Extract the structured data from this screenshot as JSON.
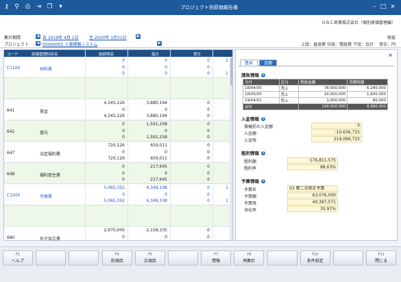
{
  "window": {
    "title": "プロジェクト別原価報告書"
  },
  "header": {
    "period_label": "集計期間",
    "project_label": "プロジェクト",
    "period_from": "自 2019年 4月 1日",
    "period_to": "至 2020年 3月31日",
    "project_value": "00000001 人事情報システム",
    "company": "ＯＢＣ商事株式会社（個別原価管理編）",
    "tax": "税抜",
    "legend": "上段：直接費 中段：間接費 下段：合計",
    "unit": "単位：円"
  },
  "grid": {
    "headers": [
      "コード",
      "原価管理科目名",
      "総経残高",
      "借方",
      "貸方"
    ],
    "rows": [
      {
        "code": "C1100",
        "name": "材料費",
        "blue": true,
        "green": false,
        "cells": [
          [
            "0",
            "0",
            "0",
            "1"
          ],
          [
            "0",
            "0",
            "0",
            ""
          ],
          [
            "0",
            "0",
            "0",
            "1"
          ]
        ]
      },
      {
        "code": "",
        "name": "",
        "blue": false,
        "green": true,
        "cells": [
          [
            "",
            "",
            "",
            ""
          ],
          [
            "",
            "",
            "",
            ""
          ],
          [
            "",
            "",
            "",
            ""
          ]
        ]
      },
      {
        "code": "641",
        "name": "賃金",
        "blue": false,
        "green": false,
        "cells": [
          [
            "4,345,226",
            "3,880,194",
            "0",
            ""
          ],
          [
            "0",
            "0",
            "0",
            ""
          ],
          [
            "4,345,226",
            "3,880,194",
            "0",
            ""
          ]
        ]
      },
      {
        "code": "642",
        "name": "賞与",
        "blue": false,
        "green": true,
        "cells": [
          [
            "0",
            "1,591,258",
            "0",
            ""
          ],
          [
            "0",
            "0",
            "0",
            ""
          ],
          [
            "0",
            "1,591,258",
            "0",
            ""
          ]
        ]
      },
      {
        "code": "647",
        "name": "法定福利費",
        "blue": false,
        "green": false,
        "cells": [
          [
            "720,126",
            "659,011",
            "0",
            ""
          ],
          [
            "0",
            "0",
            "0",
            ""
          ],
          [
            "720,126",
            "659,011",
            "0",
            ""
          ]
        ]
      },
      {
        "code": "648",
        "name": "福利厚生費",
        "blue": false,
        "green": true,
        "cells": [
          [
            "0",
            "217,645",
            "0",
            ""
          ],
          [
            "0",
            "0",
            "0",
            ""
          ],
          [
            "0",
            "217,645",
            "0",
            ""
          ]
        ]
      },
      {
        "code": "C1200",
        "name": "労務費",
        "blue": true,
        "green": false,
        "cells": [
          [
            "5,065,352",
            "6,348,108",
            "0",
            "1"
          ],
          [
            "0",
            "0",
            "0",
            ""
          ],
          [
            "5,065,352",
            "6,348,108",
            "0",
            "1"
          ]
        ]
      },
      {
        "code": "",
        "name": "",
        "blue": false,
        "green": true,
        "cells": [
          [
            "",
            "",
            "",
            ""
          ],
          [
            "",
            "",
            "",
            ""
          ],
          [
            "",
            "",
            "",
            ""
          ]
        ]
      },
      {
        "code": "680",
        "name": "外注加工費",
        "blue": false,
        "green": false,
        "cells": [
          [
            "2,970,000",
            "2,158,335",
            "0",
            ""
          ],
          [
            "0",
            "0",
            "0",
            ""
          ],
          [
            "2,970,000",
            "2,158,335",
            "0",
            ""
          ]
        ]
      }
    ]
  },
  "panel": {
    "tabs": [
      "基本",
      "金額"
    ],
    "sales": {
      "title": "請負情報",
      "cols": [
        "日付",
        "区分",
        "税抜金額",
        "消費税額"
      ],
      "rows": [
        [
          "18/04/05",
          "売上",
          "78,500,000",
          "6,280,000"
        ],
        [
          "18/05/05",
          "売上",
          "20,000,000",
          "1,600,000"
        ],
        [
          "19/04/01",
          "売上",
          "1,000,000",
          "80,000"
        ]
      ],
      "total": [
        "合計",
        "199,500,000",
        "8,960,000"
      ]
    },
    "receipt": {
      "title": "入金情報",
      "rows": [
        [
          "債権前の入金額",
          "0"
        ],
        [
          "入金額",
          "-10,636,725"
        ],
        [
          "入金残",
          "219,096,725"
        ]
      ]
    },
    "profit": {
      "title": "粗利情報",
      "rows": [
        [
          "粗利額",
          "176,811,575"
        ],
        [
          "粗利率",
          "88.63%"
        ]
      ]
    },
    "budget": {
      "title": "予算情報",
      "rows": [
        [
          "予算名",
          "03 第二次修正予算"
        ],
        [
          "予算額",
          "63,076,000"
        ],
        [
          "予算残",
          "40,387,571"
        ],
        [
          "消化率",
          "35.97%"
        ]
      ]
    }
  },
  "fkeys": [
    {
      "n": "F1",
      "l": "ヘルプ"
    },
    {
      "n": "",
      "l": ""
    },
    {
      "n": "",
      "l": ""
    },
    {
      "n": "F4",
      "l": "前項目"
    },
    {
      "n": "F5",
      "l": "次項目"
    },
    {
      "n": "",
      "l": ""
    },
    {
      "n": "F7",
      "l": "情報"
    },
    {
      "n": "F8",
      "l": "再集計"
    },
    {
      "n": "",
      "l": ""
    },
    {
      "n": "F10",
      "l": "条件設定"
    },
    {
      "n": "",
      "l": ""
    },
    {
      "n": "F12",
      "l": "閉じる"
    }
  ]
}
